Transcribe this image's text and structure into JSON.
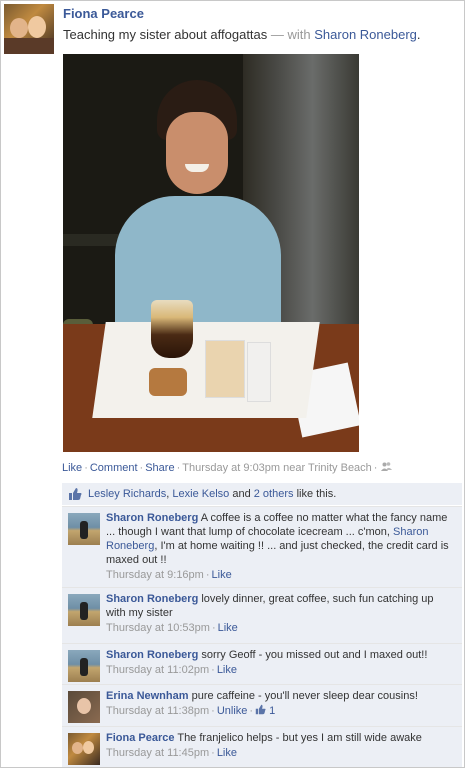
{
  "post": {
    "author": "Fiona Pearce",
    "status_text": "Teaching my sister about affogattas",
    "with_sep": " — with ",
    "tagged": "Sharon Roneberg",
    "tagged_end": "."
  },
  "actions": {
    "like": "Like",
    "comment": "Comment",
    "share": "Share",
    "sep": "·",
    "time_place": "Thursday at 9:03pm near Trinity Beach"
  },
  "likes": {
    "name1": "Lesley Richards",
    "comma": ",",
    "name2": "Lexie Kelso",
    "and": "and",
    "others": "2 others",
    "suffix": "like this."
  },
  "comments": [
    {
      "name": "Sharon Roneberg",
      "text_before": "A coffee is a coffee no matter what the fancy name ... though I want that lump of chocolate icecream ... c'mon,",
      "mention": "Sharon Roneberg",
      "text_after": ", I'm at home waiting !! ... and just checked, the credit card is maxed out !!",
      "time": "Thursday at 9:16pm",
      "action": "Like"
    },
    {
      "name": "Sharon Roneberg",
      "text": "lovely dinner, great coffee, such fun catching up with my sister",
      "time": "Thursday at 10:53pm",
      "action": "Like"
    },
    {
      "name": "Sharon Roneberg",
      "text": "sorry Geoff - you missed out and I maxed out!!",
      "time": "Thursday at 11:02pm",
      "action": "Like"
    },
    {
      "name": "Erina Newnham",
      "text": "pure caffeine - you'll never sleep dear cousins!",
      "time": "Thursday at 11:38pm",
      "action": "Unlike",
      "like_count": "1"
    },
    {
      "name": "Fiona Pearce",
      "text": "The franjelico helps - but yes I am still wide awake",
      "time": "Thursday at 11:45pm",
      "action": "Like"
    }
  ],
  "colors": {
    "link": "#3b5998",
    "meta": "#999999",
    "comment_bg": "#eceff5"
  }
}
